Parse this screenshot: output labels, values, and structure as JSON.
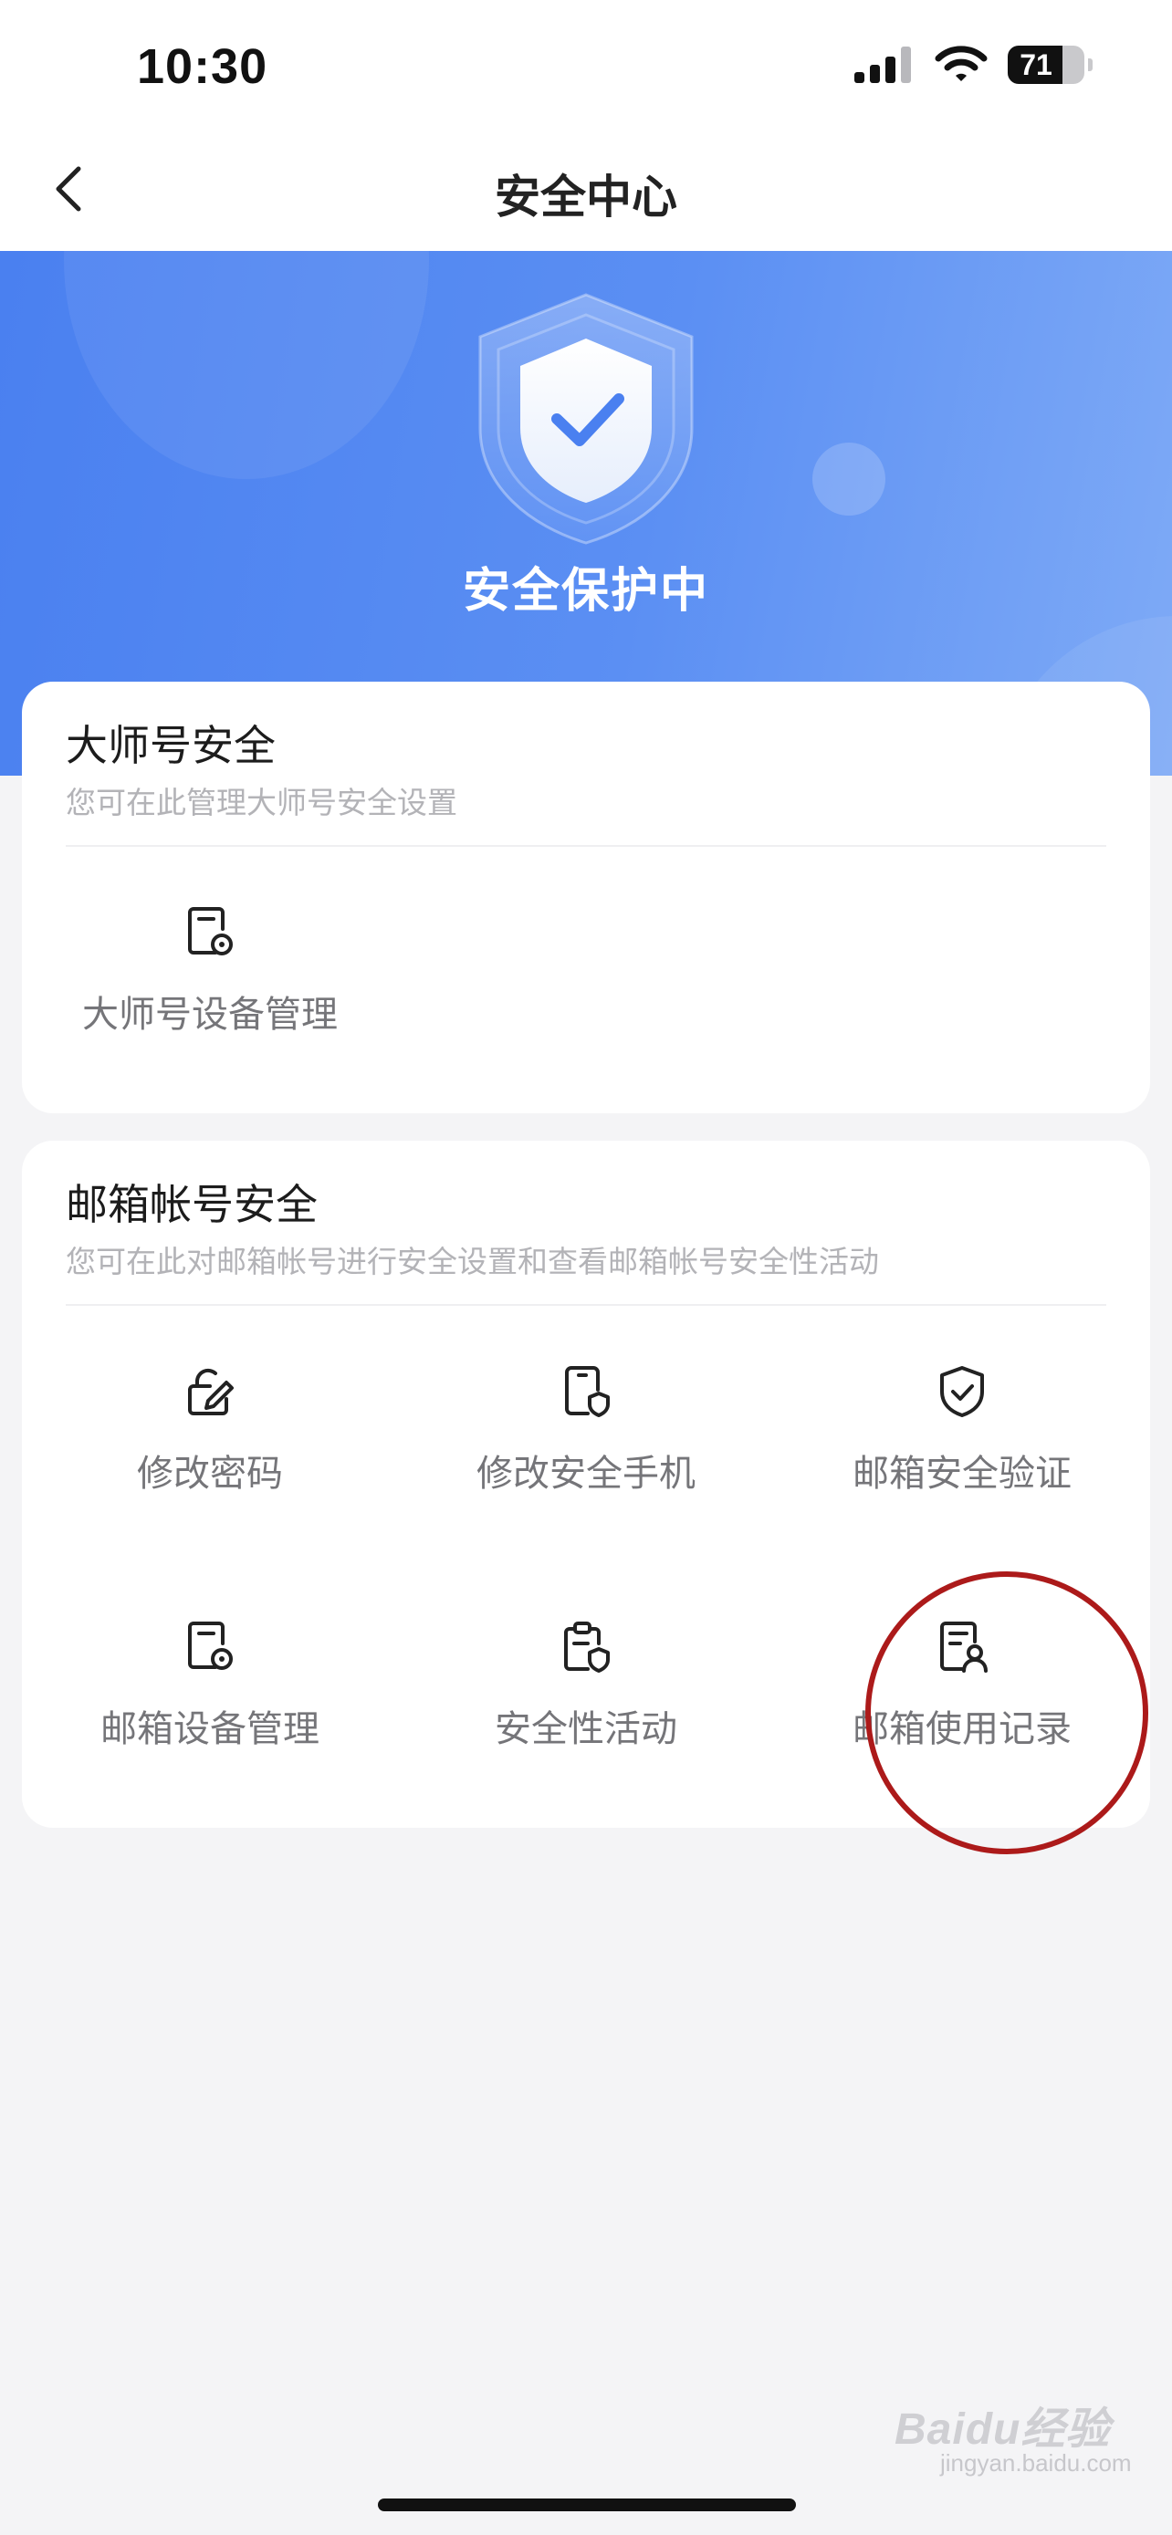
{
  "status_bar": {
    "time": "10:30",
    "battery_percent": 71,
    "battery_text": "71",
    "icons": [
      "cellular-signal-icon",
      "wifi-icon",
      "battery-icon"
    ]
  },
  "nav": {
    "back_icon": "chevron-left-icon",
    "title": "安全中心"
  },
  "hero": {
    "icon": "shield-check-icon",
    "status_text": "安全保护中",
    "gradient_colors": [
      "#4a80f0",
      "#7eaaf6"
    ]
  },
  "master_account_section": {
    "title": "大师号安全",
    "subtitle": "您可在此管理大师号安全设置",
    "items": [
      {
        "label": "大师号设备管理",
        "icon": "device-settings-icon"
      }
    ]
  },
  "mailbox_section": {
    "title": "邮箱帐号安全",
    "subtitle": "您可在此对邮箱帐号进行安全设置和查看邮箱帐号安全性活动",
    "items": [
      {
        "label": "修改密码",
        "icon": "edit-password-icon"
      },
      {
        "label": "修改安全手机",
        "icon": "phone-shield-icon"
      },
      {
        "label": "邮箱安全验证",
        "icon": "shield-verify-icon"
      },
      {
        "label": "邮箱设备管理",
        "icon": "device-settings-icon"
      },
      {
        "label": "安全性活动",
        "icon": "clipboard-shield-icon"
      },
      {
        "label": "邮箱使用记录",
        "icon": "usage-record-icon"
      }
    ]
  },
  "annotation": {
    "highlighted_item": "邮箱使用记录",
    "ring_color": "#ac1a1a"
  },
  "watermark": {
    "brand": "Baidu经验",
    "url": "jingyan.baidu.com"
  },
  "colors": {
    "page_background": "#f4f4f6",
    "card_background": "#ffffff",
    "label_text": "#757579",
    "subtitle_text": "#b3b3b7"
  }
}
